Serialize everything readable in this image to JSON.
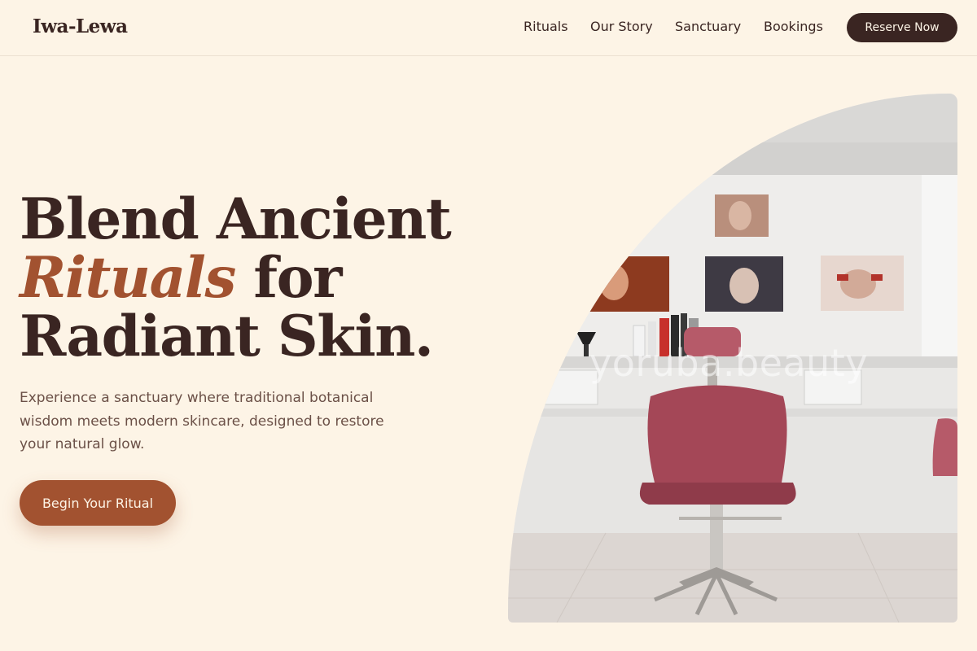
{
  "brand": {
    "name": "Iwa-Lewa"
  },
  "nav": {
    "items": [
      "Rituals",
      "Our Story",
      "Sanctuary",
      "Bookings"
    ],
    "cta_label": "Reserve Now"
  },
  "hero": {
    "headline_line1": "Blend Ancient",
    "headline_accent": "Rituals",
    "headline_line2_rest": " for",
    "headline_line3": "Radiant Skin.",
    "subtext": "Experience a sanctuary where traditional botanical wisdom meets modern skincare, designed to restore your natural glow.",
    "cta_label": "Begin Your Ritual",
    "image": {
      "subject": "beauty salon interior with a burgundy salon chair in front of a long mirror and framed beauty portraits",
      "watermark": "yoruba.beauty"
    }
  },
  "colors": {
    "background": "#fdf4e6",
    "text_dark": "#3a2522",
    "accent": "#a25230",
    "muted_text": "#6b5047"
  }
}
